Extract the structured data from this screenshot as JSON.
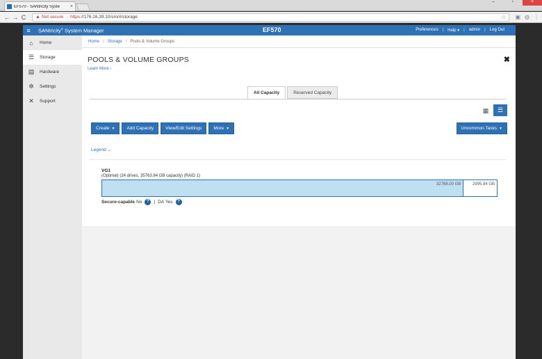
{
  "browser": {
    "tab_title": "EF570 - SANtricity Syste",
    "tab_close": "×",
    "not_secure": "Not secure",
    "url_scheme": "https",
    "url_rest": "://176.16.39.10/sm/#/storage"
  },
  "app": {
    "product": "SANtricity",
    "product_mark": "®",
    "product_suffix": " System Manager",
    "system_name": "EF570",
    "header_links": [
      "Preferences",
      "Help ▾",
      "admin",
      "Log Out"
    ]
  },
  "sidebar": {
    "items": [
      {
        "label": "Home",
        "icon": "home-icon"
      },
      {
        "label": "Storage",
        "icon": "storage-icon"
      },
      {
        "label": "Hardware",
        "icon": "hardware-icon"
      },
      {
        "label": "Settings",
        "icon": "gear-icon"
      },
      {
        "label": "Support",
        "icon": "tools-icon"
      }
    ],
    "active": "Storage"
  },
  "breadcrumb": [
    "Home",
    "Storage",
    "Pools & Volume Groups"
  ],
  "page": {
    "title": "POOLS & VOLUME GROUPS",
    "learn_more": "Learn More ›",
    "close": "✖"
  },
  "tabs": [
    "All Capacity",
    "Reserved Capacity"
  ],
  "active_tab": "All Capacity",
  "toolbar": {
    "create": "Create",
    "add_capacity": "Add Capacity",
    "view_edit": "View/Edit Settings",
    "more": "More",
    "uncommon": "Uncommon Tasks"
  },
  "legend": "Legend",
  "pool": {
    "name": "VG1",
    "description": "(Optimal) (24 drives, 35763.84 GB capacity) (RAID 1)",
    "used_label": "32768.00 GB",
    "free_label": "2995.84 GB",
    "used_fraction": 0.916,
    "secure_capable_label": "Secure-capable",
    "secure_capable_value": "No",
    "da_label": "DA",
    "da_value": "Yes",
    "separator": "|"
  },
  "colors": {
    "brand": "#2e71b5",
    "capacity_used": "#bfe0f0",
    "not_secure": "#c0392b"
  }
}
